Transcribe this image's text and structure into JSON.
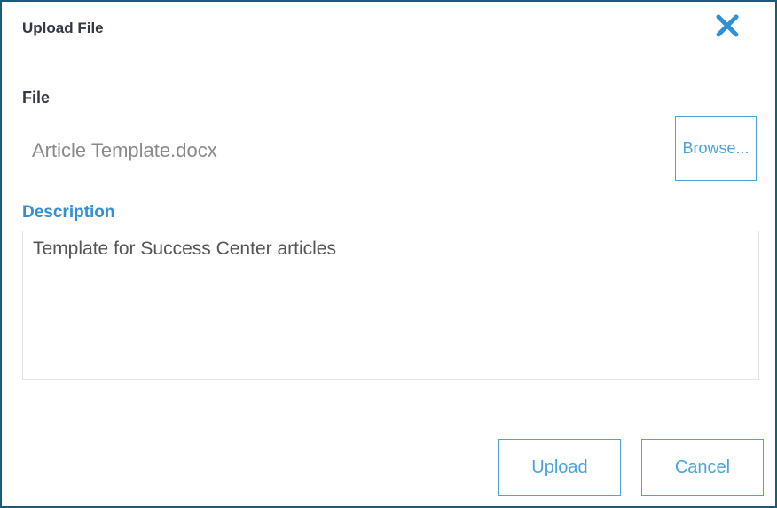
{
  "dialog": {
    "title": "Upload File",
    "close_icon": "close-icon",
    "accent_color": "#2f8fd8"
  },
  "file": {
    "label": "File",
    "value": "Article Template.docx",
    "browse_label": "Browse..."
  },
  "description": {
    "label": "Description",
    "value": "Template for Success Center articles"
  },
  "actions": {
    "upload_label": "Upload",
    "cancel_label": "Cancel"
  }
}
